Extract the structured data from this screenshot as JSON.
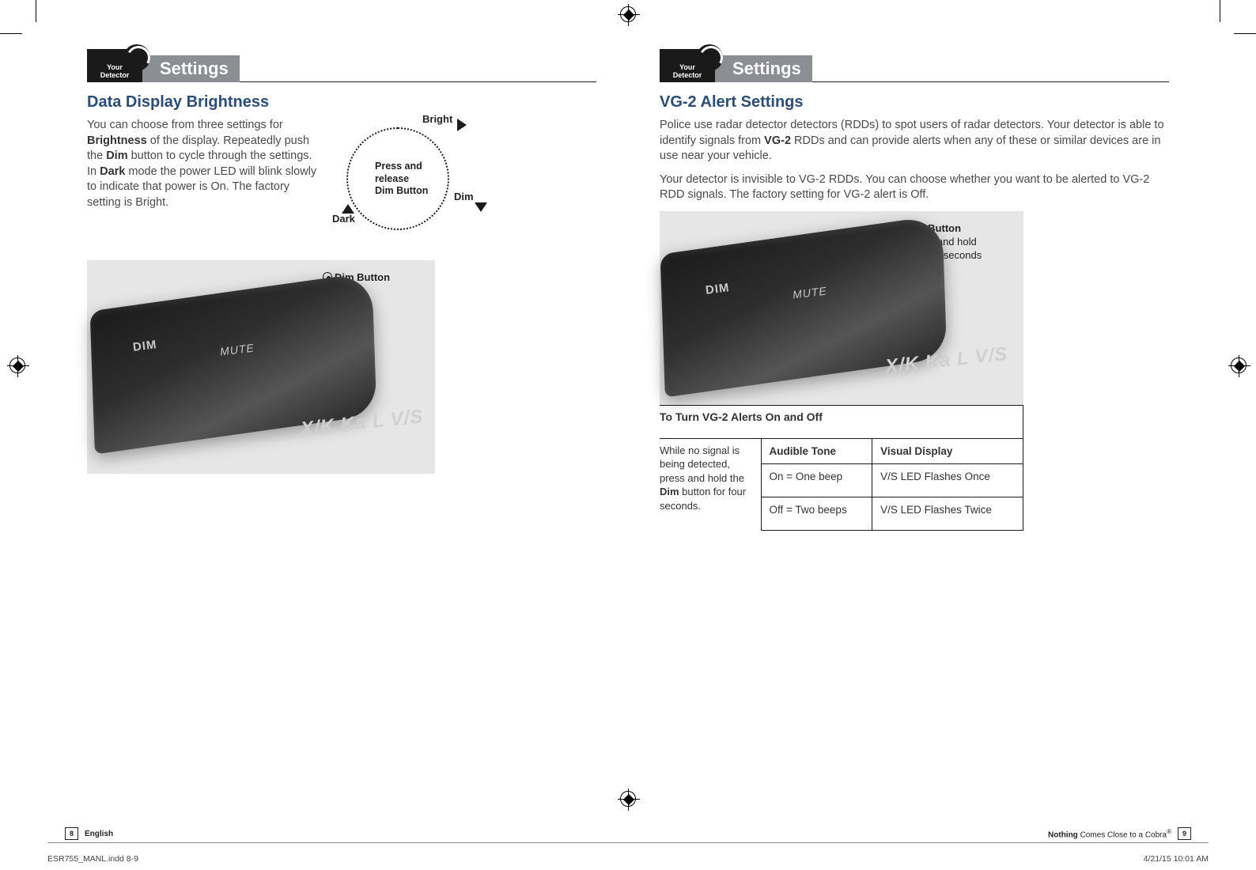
{
  "header": {
    "tab_text": "Your Detector",
    "title": "Settings"
  },
  "left": {
    "section_title": "Data Display Brightness",
    "body_html": "You can choose from three settings for <b>Brightness</b> of the display. Repeatedly push the <b>Dim</b> button to cycle through the settings. In <b>Dark</b> mode the power LED will blink slowly to indicate that power is On. The factory setting is Bright.",
    "cycle": {
      "bright": "Bright",
      "dim": "Dim",
      "dark": "Dark",
      "inner": "Press and\nrelease\nDim Button"
    },
    "dim_callout": "Dim Button",
    "device": {
      "dim": "DIM",
      "mute": "MUTE",
      "xk": "X/K Ka  L  V/S"
    },
    "footer": {
      "page": "8",
      "lang": "English"
    }
  },
  "right": {
    "section_title": "VG-2 Alert Settings",
    "body1_html": "Police use radar detector detectors (RDDs) to spot users of radar detectors. Your detector is able to identify signals from <b>VG-2</b> RDDs and can provide alerts when any of these or similar devices are in use near your vehicle.",
    "body2": "Your detector is invisible to VG-2 RDDs. You can choose whether you want to be alerted to VG-2 RDD signals. The factory setting for VG-2 alert is Off.",
    "dim_callout": "Dim Button",
    "dim_callout_sub": "Press and hold\nfor four seconds",
    "table": {
      "caption": "To Turn VG-2 Alerts On and Off",
      "side_html": "While no signal is being detected, press and hold the <b>Dim</b> button for four seconds.",
      "col1": "Audible Tone",
      "col2": "Visual Display",
      "rows": [
        {
          "a": "On = One beep",
          "b": "V/S LED Flashes Once"
        },
        {
          "a": "Off = Two beeps",
          "b": "V/S LED Flashes Twice"
        }
      ]
    },
    "device": {
      "dim": "DIM",
      "mute": "MUTE",
      "xk": "X/K Ka  L  V/S"
    },
    "footer": {
      "page": "9",
      "tagline_bold": "Nothing",
      "tagline_rest": " Comes Close to a Cobra",
      "reg": "®"
    }
  },
  "indd": {
    "file": "ESR755_MANL.indd   8-9",
    "date": "4/21/15   10:01 AM"
  }
}
